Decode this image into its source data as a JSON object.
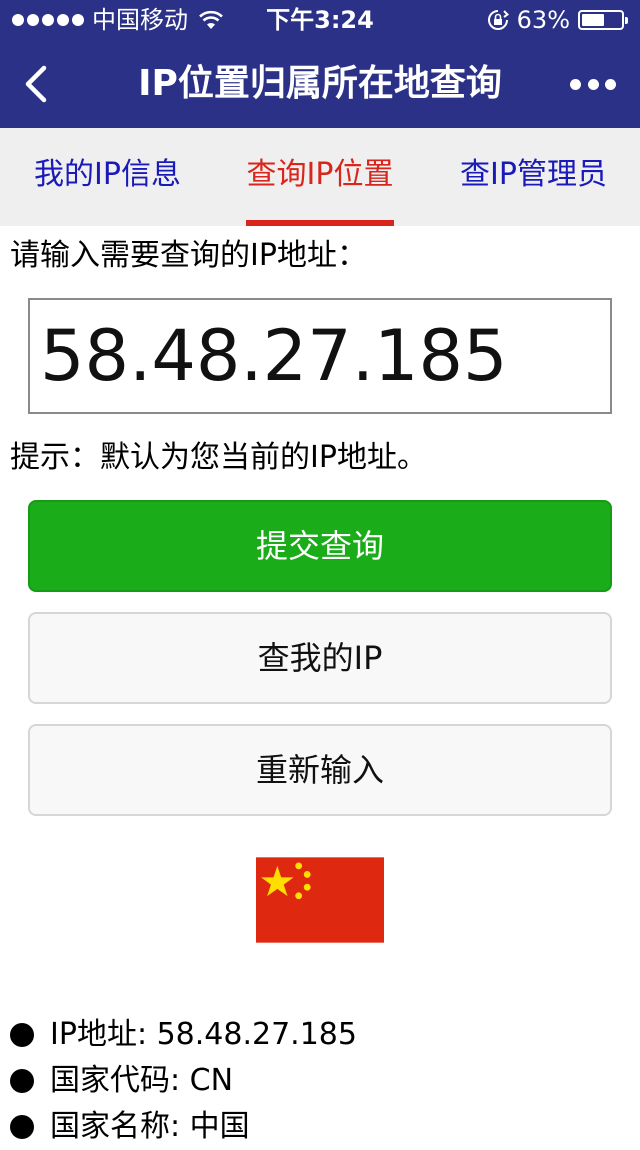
{
  "status_bar": {
    "carrier": "中国移动",
    "time": "下午3:24",
    "battery_text": "63%",
    "battery_level": 0.63,
    "signal_dots": 5
  },
  "nav": {
    "title": "IP位置归属所在地查询",
    "back_icon": "chevron-left-icon",
    "more_icon": "more-dots-icon"
  },
  "tabs": [
    {
      "label": "我的IP信息",
      "active": false
    },
    {
      "label": "查询IP位置",
      "active": true
    },
    {
      "label": "查IP管理员",
      "active": false
    }
  ],
  "form": {
    "prompt": "请输入需要查询的IP地址：",
    "ip_value": "58.48.27.185",
    "hint": "提示：默认为您当前的IP地址。",
    "submit_label": "提交查询",
    "my_ip_label": "查我的IP",
    "reset_label": "重新输入"
  },
  "flag": {
    "name": "china-flag",
    "colors": {
      "red": "#de2910",
      "yellow": "#ffde00"
    }
  },
  "results": [
    {
      "text": "IP地址: 58.48.27.185"
    },
    {
      "text": "国家代码: CN"
    },
    {
      "text": "国家名称: 中国"
    }
  ],
  "colors": {
    "nav_bg": "#2b3186",
    "tab_active": "#d8261d",
    "tab_inactive": "#1a1ab8",
    "primary_button": "#1aac19"
  }
}
